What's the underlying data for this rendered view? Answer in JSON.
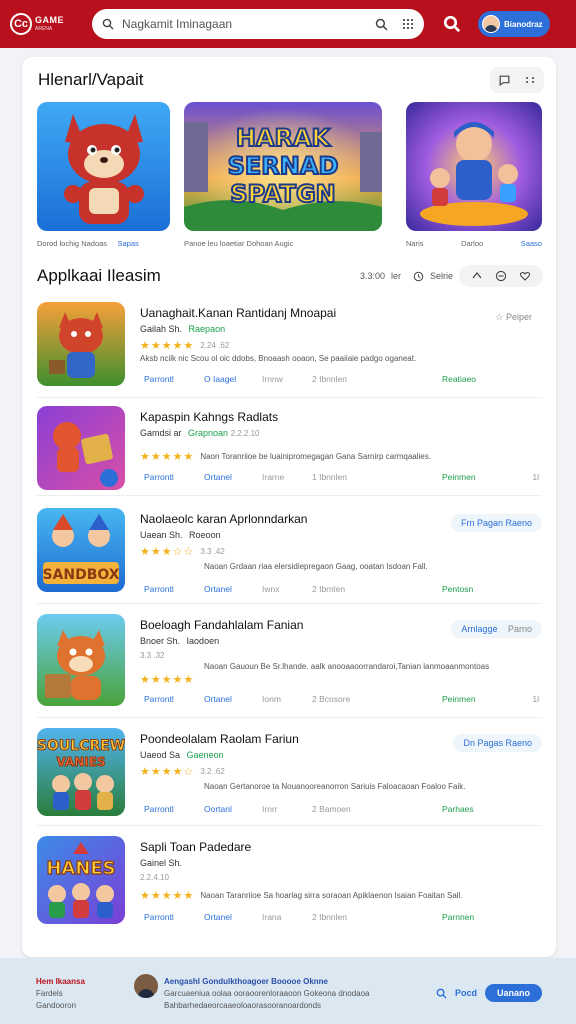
{
  "header": {
    "logo_mark": "Cc",
    "logo_title": "GAME",
    "logo_subtitle": "ARENA",
    "search_placeholder": "Nagkamit Iminagaan",
    "user_name": "Bianodraz"
  },
  "featured": {
    "title": "Hlenarl/Vapait",
    "items": [
      {
        "caption": "Dorod lochig Nadoas",
        "tag": "Sapas",
        "art_text": []
      },
      {
        "caption": "Panoe leu loaetiar Dohoan Augic",
        "tag": "",
        "art_text": [
          "HARAK",
          "SERNAD",
          "SPATGN"
        ]
      },
      {
        "caption": "Naris",
        "tag": "Darloo",
        "tag2": "Saaso",
        "art_text": []
      }
    ],
    "accent_color": "#2c6fd8"
  },
  "list": {
    "title": "Applkaai Ileasim",
    "sort_label": "3.3:00",
    "sort_unit": "ler",
    "sort_filter": "Selrie",
    "items": [
      {
        "title": "Uanaghait.Kanan Rantidanj Mnoapai",
        "dev": "Gailah Sh.",
        "dev_tag": "Raepaon",
        "size": "2.24 .62",
        "desc": "Aksb ncilk nic Scou ol oic ddobs, Bnoaash ooaon, Se paaiiaie padgo oganeat.",
        "meta_a": "Parrontl",
        "meta_b": "O Iaagel",
        "meta_c": "Irnnw",
        "meta_d": "2 Ibnnlen",
        "meta_e": "Reatiaeo",
        "meta_f": "",
        "action": "Peiper",
        "action_style": "plain",
        "stars": "★★★★★",
        "icon": "fox-red"
      },
      {
        "title": "Kapaspin Kahngs Radlats",
        "dev": "Gamdsi ar",
        "dev_tag": "Grapnoan",
        "size": "2.2.2.10",
        "desc": "Naon  Toranriioe  be  luainipromegagan  Gana  Sarnirp  carmqaalies.",
        "meta_a": "Parrontl",
        "meta_b": "Ortanel",
        "meta_c": "Irarne",
        "meta_d": "1 Ibnnlen",
        "meta_e": "Peinmen",
        "meta_f": "1l",
        "action": "",
        "action_style": "plain",
        "stars": "★★★★★",
        "icon": "puzzle-purple"
      },
      {
        "title": "Naolaeolc karan Aprlonndarkan",
        "dev": "Uaean Sh.",
        "dev_tag": "Roeoon",
        "size": "3.3 .42",
        "desc": "Naoan  Grdaan  riaa  elersidiepregaon  Gaag,  ooatan  Isdoan  Fall.",
        "meta_a": "Parrontl",
        "meta_b": "Ortanel",
        "meta_c": "Iwnx",
        "meta_d": "2 Ibrnlen",
        "meta_e": "Pentosn",
        "meta_f": "",
        "action": "Frn Pagan Raeno",
        "action_style": "pill",
        "stars": "★★★☆☆",
        "icon": "sandbox-blue"
      },
      {
        "title": "Boeloagh Fandahlalam Fanian",
        "dev": "Bnoer Sh.",
        "dev_tag": "Iaodoen",
        "size": "3.3 .32",
        "desc": "Naoan  Gauoun  Be  Sr.lhande.  aalk  anooaaoorrandaroi,Tanian  lanmoaanmontoas",
        "meta_a": "Parrontl",
        "meta_b": "Ortanel",
        "meta_c": "Ionm",
        "meta_d": "2 Bcosore",
        "meta_e": "Peinmen",
        "meta_f": "1l",
        "action": "Arnlagge",
        "action2": "Parno",
        "action_style": "pill",
        "stars": "★★★★★",
        "icon": "fox-green"
      },
      {
        "title": "Poondeolalam Raolam Fariun",
        "dev": "Uaeod Sa",
        "dev_tag": "Gaeneon",
        "size": "3.2 .62",
        "desc": "Naoan  Gertanoroe  ta  Nouanooreanorron  Sariuis  Faloacaoan  Foaloo  Faik.",
        "meta_a": "Parrontl",
        "meta_b": "Oortanl",
        "meta_c": "Irnrr",
        "meta_d": "2 Bamoen",
        "meta_e": "Parhaes",
        "meta_f": "",
        "action": "Dn Pagas Raeno",
        "action_style": "pill",
        "stars": "★★★★☆",
        "icon": "soulcrew"
      },
      {
        "title": "Sapli Toan Padedare",
        "dev": "Gainel Sh.",
        "dev_tag": "",
        "size": "2.2.4.10",
        "desc": "Naoan  Taranriioe  Sa  hoarlag  sirra  soraoan  Apiklaenon  Isaian  Foaitan  Sall.",
        "meta_a": "Parrontl",
        "meta_b": "Ortanel",
        "meta_c": "Irana",
        "meta_d": "2 Ibnnlen",
        "meta_e": "Parnnen",
        "meta_f": "",
        "action": "",
        "action_style": "plain",
        "stars": "★★★★★",
        "icon": "hanes"
      }
    ]
  },
  "footer": {
    "left_title": "Hem Ikaansa",
    "left_line2": "Fardels",
    "left_line3": "Gandooron",
    "mid_title": "Aengashl Gondulkthoagoer  Booooe  Oknne",
    "mid_line2": "Garcuaeniua oolaa ooraoorenloraaoon  Gokeona  dnodaoa",
    "mid_line3": "Bahbarhedaeorcaaeoloaorasooranoardonds",
    "link": "Pocd",
    "button": "Uanano"
  },
  "colors": {
    "brand_red": "#b8101d",
    "accent_blue": "#2c6fd8",
    "green": "#1b9e4b",
    "star": "#f2b21b"
  }
}
